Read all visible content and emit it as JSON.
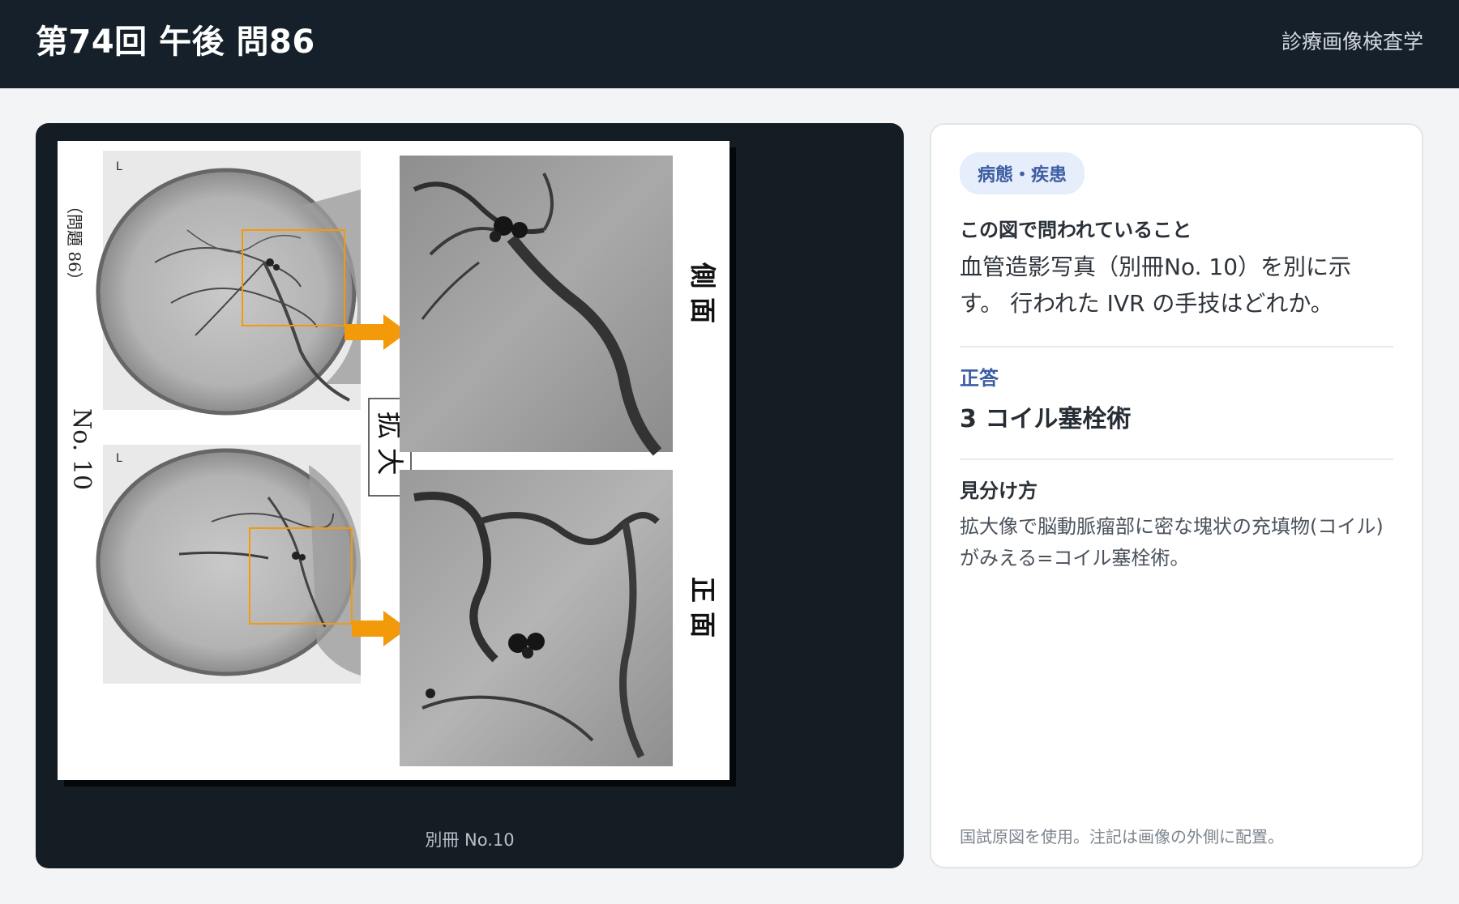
{
  "header": {
    "title": "第74回 午後 問86",
    "subject": "診療画像検査学"
  },
  "figure": {
    "booklet_no_label": "No. 10",
    "problem_label": "（問題 86）",
    "enlarge_label": "拡 大",
    "lateral_label": "側 面",
    "frontal_label": "正 面",
    "marker_L": "L",
    "caption": "別冊 No.10"
  },
  "info": {
    "category_badge": "病態・疾患",
    "question_label": "この図で問われていること",
    "question_text": "血管造影写真（別冊No. 10）を別に示す。 行われた IVR の手技はどれか。",
    "answer_label": "正答",
    "answer_text": "3 コイル塞栓術",
    "tips_label": "見分け方",
    "tips_text": "拡大像で脳動脈瘤部に密な塊状の充填物(コイル)がみえる=コイル塞栓術。",
    "footnote": "国試原図を使用。注記は画像の外側に配置。"
  },
  "colors": {
    "header_bg": "#16202a",
    "viewer_bg": "#141c24",
    "accent_blue": "#3d5ea3",
    "highlight_orange": "#f39a0b"
  }
}
